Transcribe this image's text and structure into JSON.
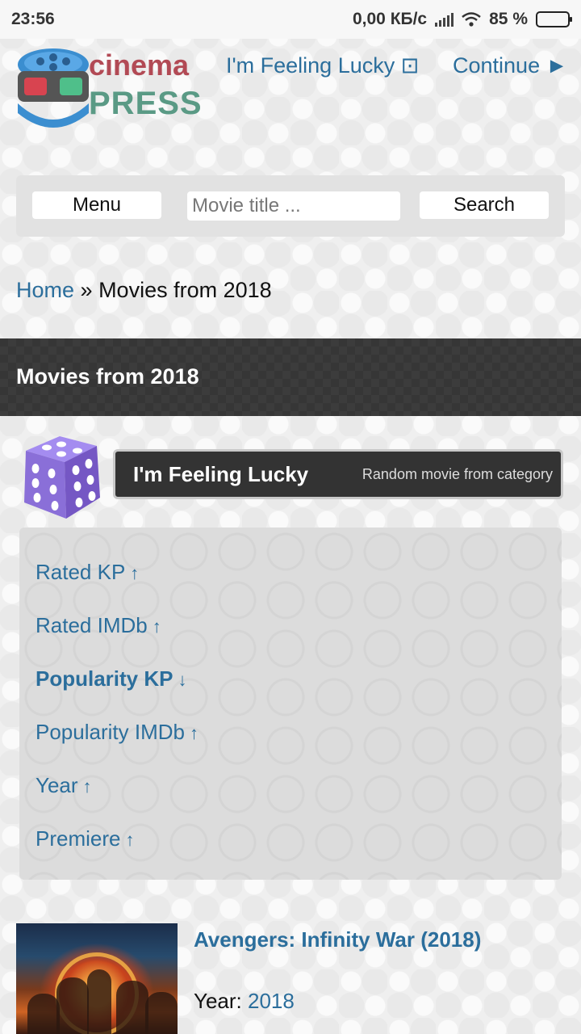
{
  "status_bar": {
    "time": "23:56",
    "network_speed": "0,00 КБ/с",
    "battery": "85 %",
    "battery_level": 0.85
  },
  "header": {
    "logo_line1": "cinema",
    "logo_line2": "PRESS",
    "lucky_link": "I'm Feeling Lucky ⊡",
    "continue_link": "Continue ►"
  },
  "search": {
    "menu_label": "Menu",
    "placeholder": "Movie title ...",
    "search_label": "Search"
  },
  "breadcrumb": {
    "home": "Home",
    "separator": " » ",
    "current": "Movies from 2018"
  },
  "page_title": "Movies from 2018",
  "lucky": {
    "title": "I'm Feeling Lucky",
    "subtitle": "Random movie from category"
  },
  "sort": {
    "items": [
      {
        "label": "Rated KP",
        "arrow": "↑"
      },
      {
        "label": "Rated IMDb",
        "arrow": "↑"
      },
      {
        "label": "Popularity KP",
        "arrow": "↓"
      },
      {
        "label": "Popularity IMDb",
        "arrow": "↑"
      },
      {
        "label": "Year",
        "arrow": "↑"
      },
      {
        "label": "Premiere",
        "arrow": "↑"
      }
    ]
  },
  "movie": {
    "title": "Avengers: Infinity War (2018)",
    "year_label": "Year: ",
    "year_value": "2018"
  },
  "colors": {
    "link": "#2b6e9c",
    "dark_bar": "#363636",
    "dice": "#8a6fd8"
  }
}
